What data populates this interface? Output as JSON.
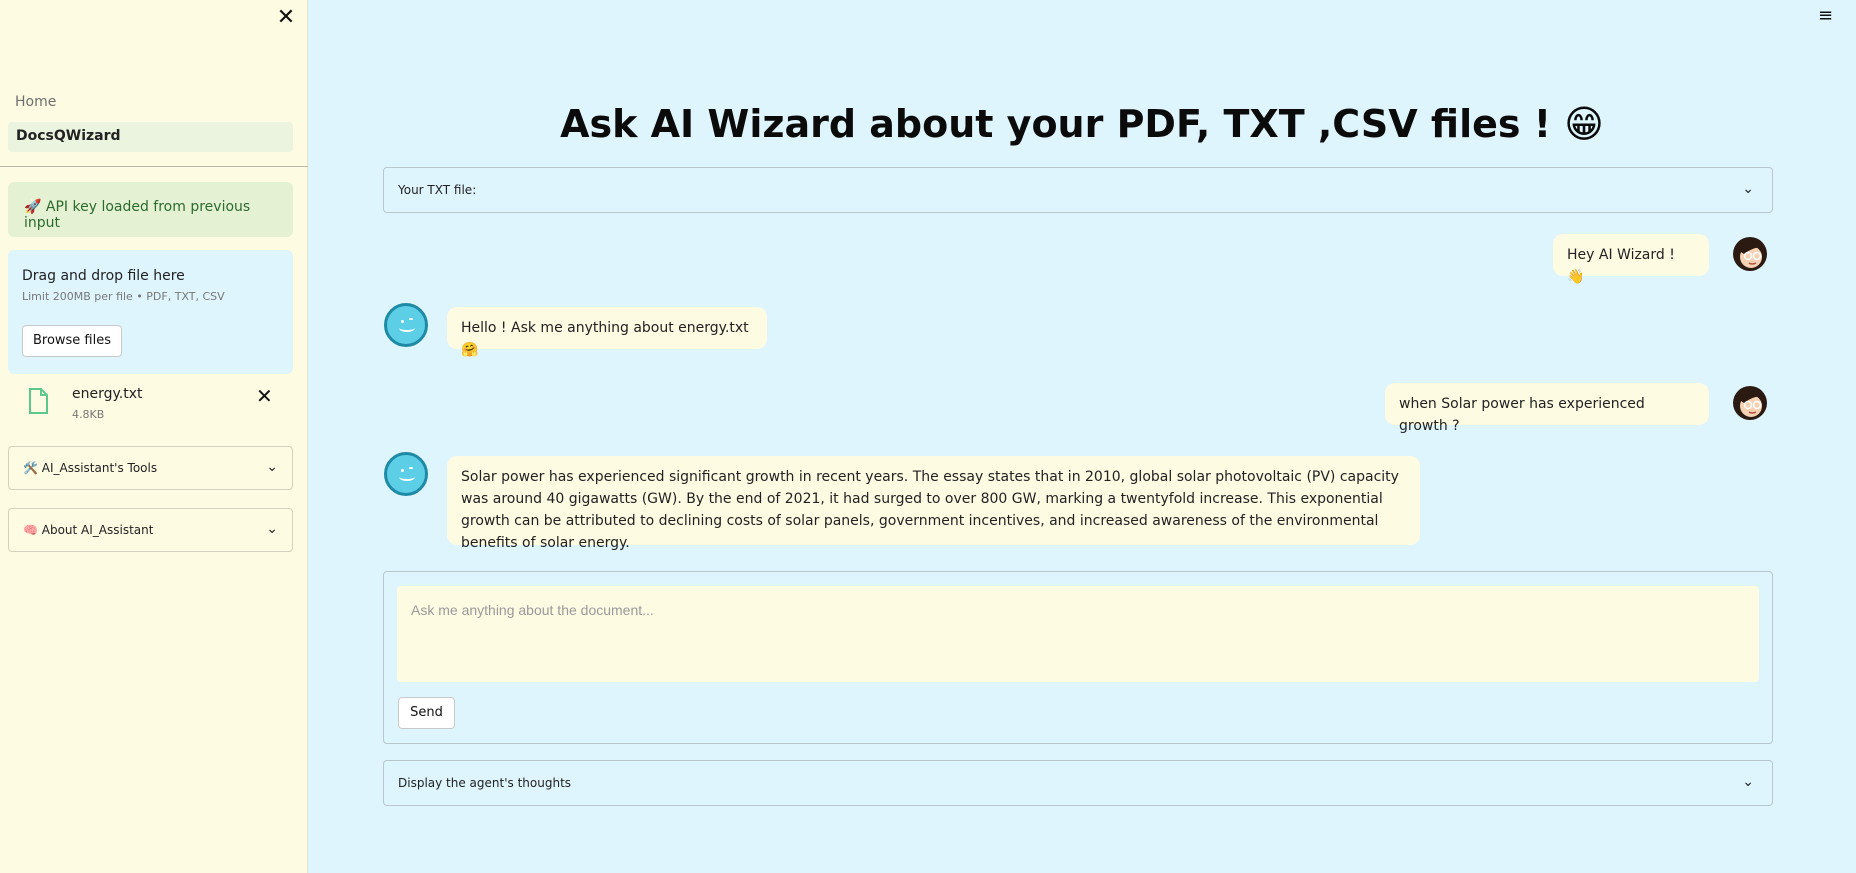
{
  "sidebar": {
    "close_glyph": "✕",
    "nav": [
      {
        "label": "Home"
      },
      {
        "label": "DocsQWizard"
      }
    ],
    "api_status": "🚀 API key loaded from previous input",
    "upload": {
      "drag_text": "Drag and drop file here",
      "limit_text": "Limit 200MB per file • PDF, TXT, CSV",
      "browse_label": "Browse files"
    },
    "file": {
      "name": "energy.txt",
      "size": "4.8KB",
      "remove_glyph": "✕"
    },
    "expanders": [
      {
        "label": "🛠️ AI_Assistant's Tools"
      },
      {
        "label": "🧠 About AI_Assistant"
      }
    ]
  },
  "main": {
    "menu_glyph": "≡",
    "title": "Ask AI Wizard about your PDF, TXT ,CSV files ! 😁",
    "file_expander": "Your TXT file:",
    "messages": [
      {
        "role": "user",
        "text": "Hey AI Wizard ! 👋"
      },
      {
        "role": "assistant",
        "text": "Hello ! Ask me anything about energy.txt 🤗"
      },
      {
        "role": "user",
        "text": "when Solar power has experienced growth ?"
      },
      {
        "role": "assistant",
        "text": "Solar power has experienced significant growth in recent years. The essay states that in 2010, global solar photovoltaic (PV) capacity was around 40 gigawatts (GW). By the end of 2021, it had surged to over 800 GW, marking a twentyfold increase. This exponential growth can be attributed to declining costs of solar panels, government incentives, and increased awareness of the environmental benefits of solar energy."
      }
    ],
    "input": {
      "placeholder": "Ask me anything about the document...",
      "value": ""
    },
    "send_label": "Send",
    "thoughts_expander": "Display the agent's thoughts",
    "chevron_glyph": "⌄"
  },
  "colors": {
    "sidebar_bg": "#fefbe3",
    "main_bg": "#dff5fd",
    "bubble_bg": "#fefbe3",
    "api_bg": "#e4f2d3",
    "api_text": "#2b6a2e"
  }
}
